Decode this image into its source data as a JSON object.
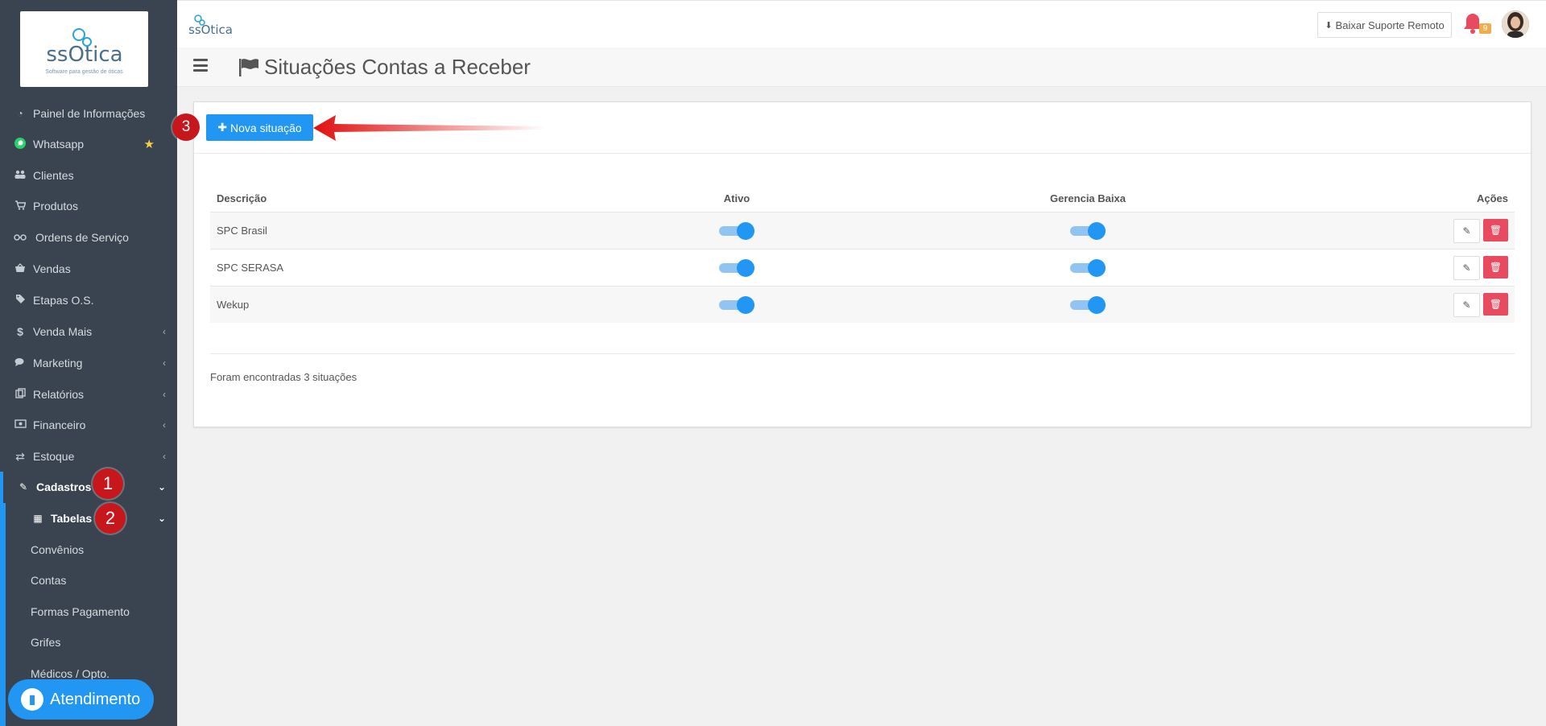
{
  "brand": {
    "logo_text": "ssOtica",
    "logo_tagline": "Software para gestão de óticas",
    "top_logo_text": "ssOtica"
  },
  "sidebar": {
    "items": [
      {
        "label": "Painel de Informações",
        "icon": "dashboard-icon",
        "glyph": "◔"
      },
      {
        "label": "Whatsapp",
        "icon": "whatsapp-icon",
        "glyph": "✆"
      },
      {
        "label": "Clientes",
        "icon": "users-icon",
        "glyph": "👥"
      },
      {
        "label": "Produtos",
        "icon": "cart-icon",
        "glyph": "🛒"
      },
      {
        "label": "Ordens de Serviço",
        "icon": "glasses-icon",
        "glyph": "oo"
      },
      {
        "label": "Vendas",
        "icon": "basket-icon",
        "glyph": "⌂"
      },
      {
        "label": "Etapas O.S.",
        "icon": "tags-icon",
        "glyph": "◈"
      },
      {
        "label": "Venda Mais",
        "icon": "dollar-icon",
        "glyph": "$"
      },
      {
        "label": "Marketing",
        "icon": "comments-icon",
        "glyph": "💬"
      },
      {
        "label": "Relatórios",
        "icon": "copy-icon",
        "glyph": "⧉"
      },
      {
        "label": "Financeiro",
        "icon": "money-icon",
        "glyph": "▣"
      },
      {
        "label": "Estoque",
        "icon": "exchange-icon",
        "glyph": "⇄"
      },
      {
        "label": "Cadastros",
        "icon": "edit-icon",
        "glyph": "✎"
      }
    ],
    "tabelas": {
      "label": "Tabelas",
      "glyph": "▦"
    },
    "sub_items": [
      "Convênios",
      "Contas",
      "Formas Pagamento",
      "Grifes",
      "Médicos / Opto."
    ],
    "steps": {
      "one": "1",
      "two": "2"
    },
    "atendimento": "Atendimento"
  },
  "topbar": {
    "remote_support": "Baixar Suporte Remoto",
    "notifications_count": "9"
  },
  "header": {
    "title": "Situações Contas a Receber"
  },
  "card": {
    "new_button": "Nova situação",
    "step_three": "3",
    "columns": [
      "Descrição",
      "Ativo",
      "Gerencia Baixa",
      "Ações"
    ],
    "rows": [
      {
        "descricao": "SPC Brasil",
        "ativo": true,
        "gerencia_baixa": true
      },
      {
        "descricao": "SPC SERASA",
        "ativo": true,
        "gerencia_baixa": true
      },
      {
        "descricao": "Wekup",
        "ativo": true,
        "gerencia_baixa": true
      }
    ],
    "found_text": "Foram encontradas 3 situações"
  },
  "colors": {
    "accent": "#2196f3",
    "sidebar_bg": "#3a4450",
    "danger": "#e84a5f",
    "step_badge": "#c8161d"
  }
}
